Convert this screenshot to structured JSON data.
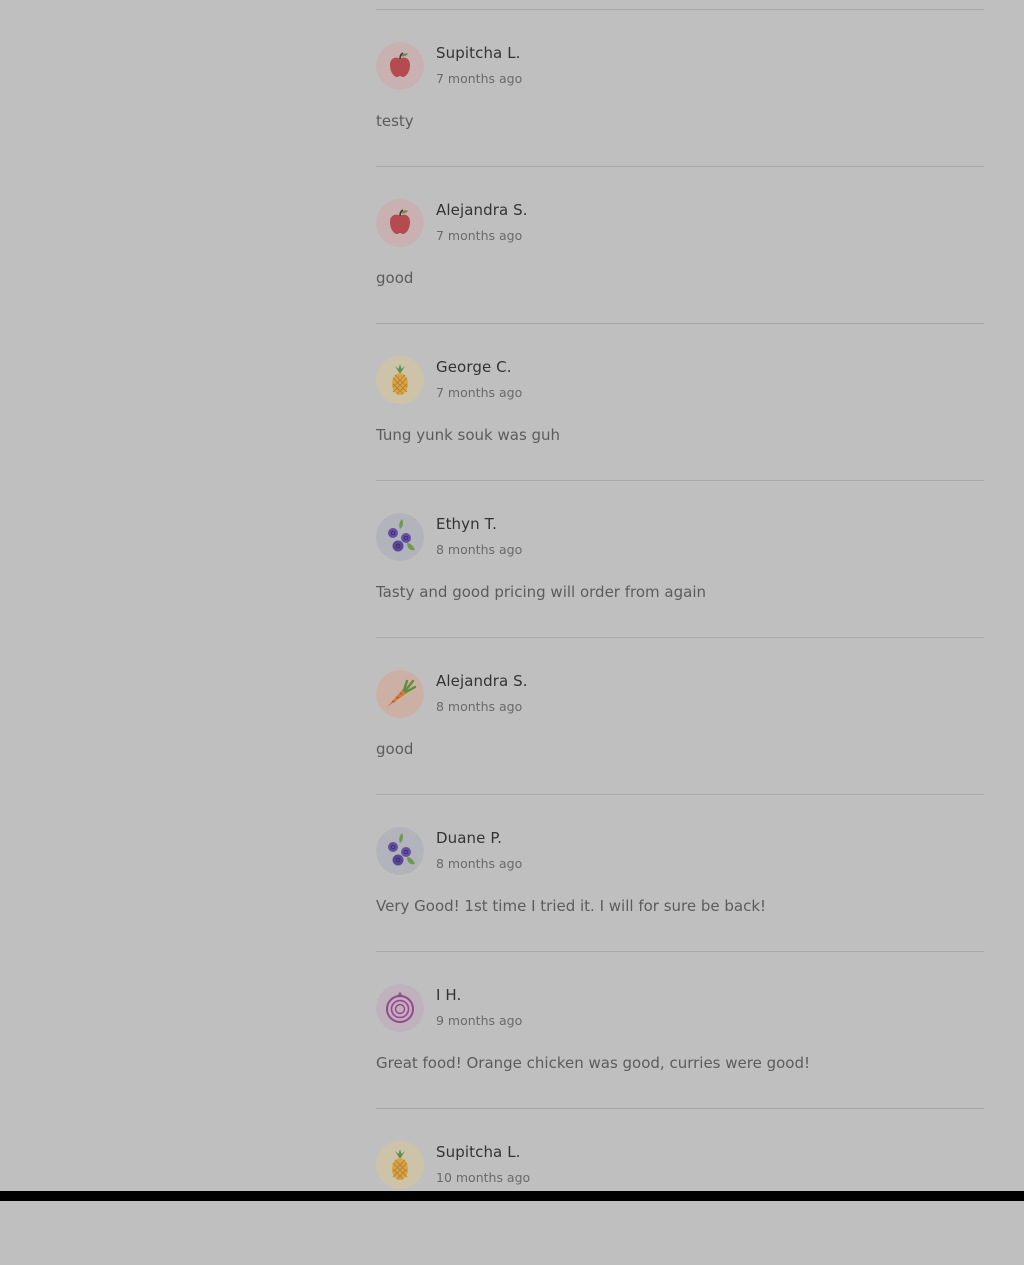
{
  "reviews": [
    {
      "name": "Supitcha L.",
      "date": "7 months ago",
      "text": "testy",
      "avatar_icon": "apple-icon"
    },
    {
      "name": "Alejandra S.",
      "date": "7 months ago",
      "text": "good",
      "avatar_icon": "apple-icon"
    },
    {
      "name": "George C.",
      "date": "7 months ago",
      "text": "Tung yunk souk was guh",
      "avatar_icon": "pineapple-icon"
    },
    {
      "name": "Ethyn T.",
      "date": "8 months ago",
      "text": "Tasty and good pricing will order from again",
      "avatar_icon": "blueberry-icon"
    },
    {
      "name": "Alejandra S.",
      "date": "8 months ago",
      "text": "good",
      "avatar_icon": "carrot-icon"
    },
    {
      "name": "Duane P.",
      "date": "8 months ago",
      "text": "Very Good! 1st time I tried it. I will for sure be back!",
      "avatar_icon": "blueberry-icon"
    },
    {
      "name": "I H.",
      "date": "9 months ago",
      "text": "Great food! Orange chicken was good, curries were good!",
      "avatar_icon": "onion-icon"
    },
    {
      "name": "Supitcha L.",
      "date": "10 months ago",
      "text": "",
      "avatar_icon": "pineapple-icon"
    }
  ],
  "colors": {
    "overlay_background": "#bfbfbf",
    "divider": "#a9a9a9",
    "name_text": "#333333",
    "date_text": "#6a6a6a",
    "body_text": "#5c5c5c"
  }
}
